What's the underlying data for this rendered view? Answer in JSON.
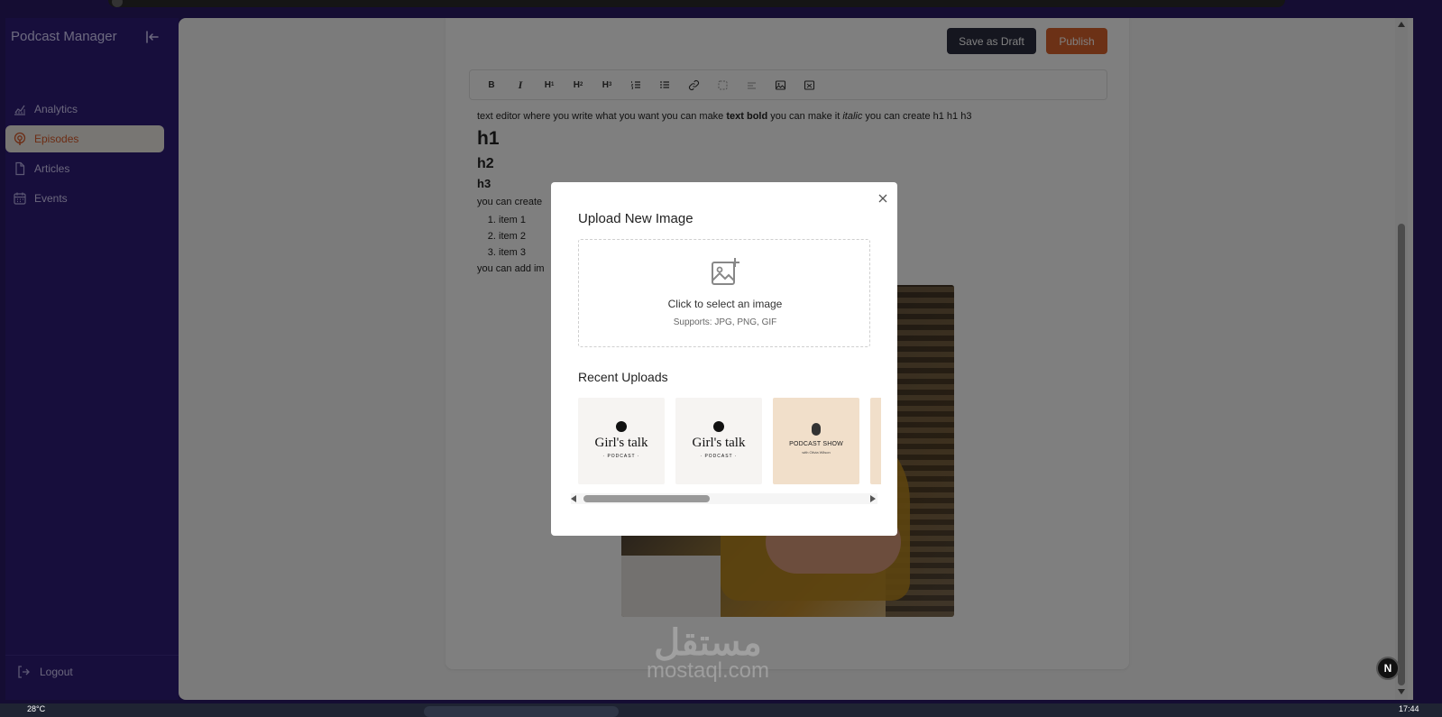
{
  "sidebar": {
    "brand": "Podcast Manager",
    "items": [
      {
        "label": "Analytics",
        "icon": "chart-icon",
        "active": false
      },
      {
        "label": "Episodes",
        "icon": "podcast-icon",
        "active": true
      },
      {
        "label": "Articles",
        "icon": "document-icon",
        "active": false
      },
      {
        "label": "Events",
        "icon": "calendar-icon",
        "active": false
      }
    ],
    "logout": "Logout"
  },
  "header": {
    "save_draft": "Save as Draft",
    "publish": "Publish"
  },
  "toolbar": {
    "tools": [
      "B",
      "I",
      "H1",
      "H2",
      "H3",
      "ordered-list",
      "bullet-list",
      "link",
      "unlink",
      "clear-format",
      "image",
      "gallery"
    ]
  },
  "editor": {
    "intro_before_bold": "text editor where you write what you want you can make ",
    "bold_text": "text bold",
    "intro_mid": " you can make it ",
    "italic_text": "italic",
    "intro_after": " you can create h1 h1 h3",
    "h1": "h1",
    "h2": "h2",
    "h3": "h3",
    "list_intro": "you can create",
    "list_items": [
      "item 1",
      "item 2",
      "item 3"
    ],
    "image_intro": "you can add im"
  },
  "modal": {
    "title": "Upload New Image",
    "dropzone_text": "Click to select an image",
    "dropzone_sub": "Supports: JPG, PNG, GIF",
    "recent_title": "Recent Uploads",
    "thumbs": [
      {
        "title": "Girl's talk",
        "sub": "· PODCAST ·"
      },
      {
        "title": "Girl's talk",
        "sub": "· PODCAST ·"
      },
      {
        "title": "PODCAST SHOW",
        "sub": "with Olivia Wilson"
      }
    ]
  },
  "watermark": {
    "arabic": "مستقل",
    "latin": "mostaql.com"
  },
  "badge": "N",
  "taskbar": {
    "weather": "28°C",
    "time": "17:44"
  },
  "colors": {
    "sidebar_bg": "#2f1d78",
    "accent": "#d8622c",
    "draft_btn": "#2b2c3e"
  }
}
